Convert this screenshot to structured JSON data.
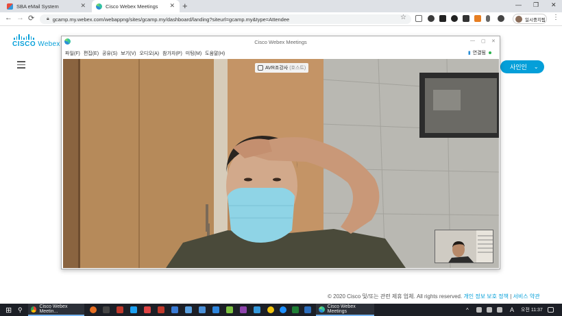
{
  "browser": {
    "tabs": [
      {
        "label": "SBA eMail System",
        "active": false
      },
      {
        "label": "Cisco Webex Meetings",
        "active": true
      }
    ],
    "new_tab": "+",
    "url": "gcamp.my.webex.com/webappng/sites/gcamp.my/dashboard/landing?siteurl=gcamp.my&type=Attendee",
    "profile_label": "일시중지됨",
    "window_controls": [
      "—",
      "❐",
      "✕"
    ]
  },
  "webex_page": {
    "brand_cisco": "CISCO",
    "brand_webex": "Webex",
    "signin_label": "사인인",
    "footer_copyright": "© 2020 Cisco 및/또는 관련 제휴 업체. All rights reserved.",
    "footer_privacy": "개인 정보 보호 정책",
    "footer_separator": "|",
    "footer_terms": "서비스 약관"
  },
  "meeting_window": {
    "title": "Cisco Webex Meetings",
    "menu": [
      "파일(F)",
      "편집(E)",
      "공유(S)",
      "보기(V)",
      "오디오(A)",
      "참가자(P)",
      "미팅(M)",
      "도움말(H)"
    ],
    "connection_label": "연결됨",
    "speaker_name": "AVR조강사",
    "speaker_role": "(호스트)"
  },
  "taskbar": {
    "apps": [
      {
        "label": "Cisco Webex Meetin..."
      },
      {
        "label": "Cisco Webex Meetings"
      }
    ],
    "ime_indicator": "A",
    "time": "오전 11:37"
  },
  "colors": {
    "accent": "#049fd9",
    "taskbar_bg": "#1c1f26",
    "connected_dot": "#2bb24c"
  }
}
